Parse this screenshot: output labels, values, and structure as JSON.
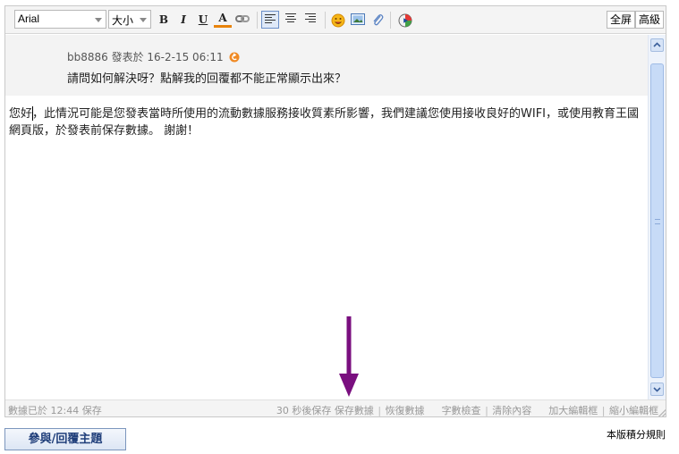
{
  "toolbar": {
    "font_family": "Arial",
    "font_size": "大小",
    "bold_label": "B",
    "italic_label": "I",
    "underline_label": "U",
    "color_label": "A",
    "fullscreen_label": "全屏",
    "advanced_label": "高級",
    "icons": [
      "bold-icon",
      "italic-icon",
      "underline-icon",
      "font-color-icon",
      "link-icon",
      "align-left-icon",
      "align-center-icon",
      "align-right-icon",
      "smiley-icon",
      "image-icon",
      "attachment-icon",
      "media-icon"
    ]
  },
  "quote": {
    "meta": "bb8886 發表於 16-2-15 06:11",
    "body": "請問如何解決呀？點解我的回覆都不能正常顯示出來？"
  },
  "message": {
    "text": "您好，此情況可能是您發表當時所使用的流動數據服務接收質素所影響，我們建議您使用接收良好的WIFI，或使用教育王國網頁版，於發表前保存數據。 謝謝！"
  },
  "statusbar": {
    "saved_text": "數據已於 12:44 保存",
    "autosave_text": "30 秒後保存",
    "save_data": "保存數據",
    "restore_data": "恢復數據",
    "word_check": "字數檢查",
    "clear_content": "清除內容",
    "enlarge_editor": "加大編輯框",
    "shrink_editor": "縮小編輯框",
    "separator": "|"
  },
  "footer": {
    "reply_button": "參與/回覆主題",
    "rules_link": "本版積分規則"
  },
  "colors": {
    "arrow": "#7a0f7f",
    "reply_text": "#1f3e7a"
  }
}
